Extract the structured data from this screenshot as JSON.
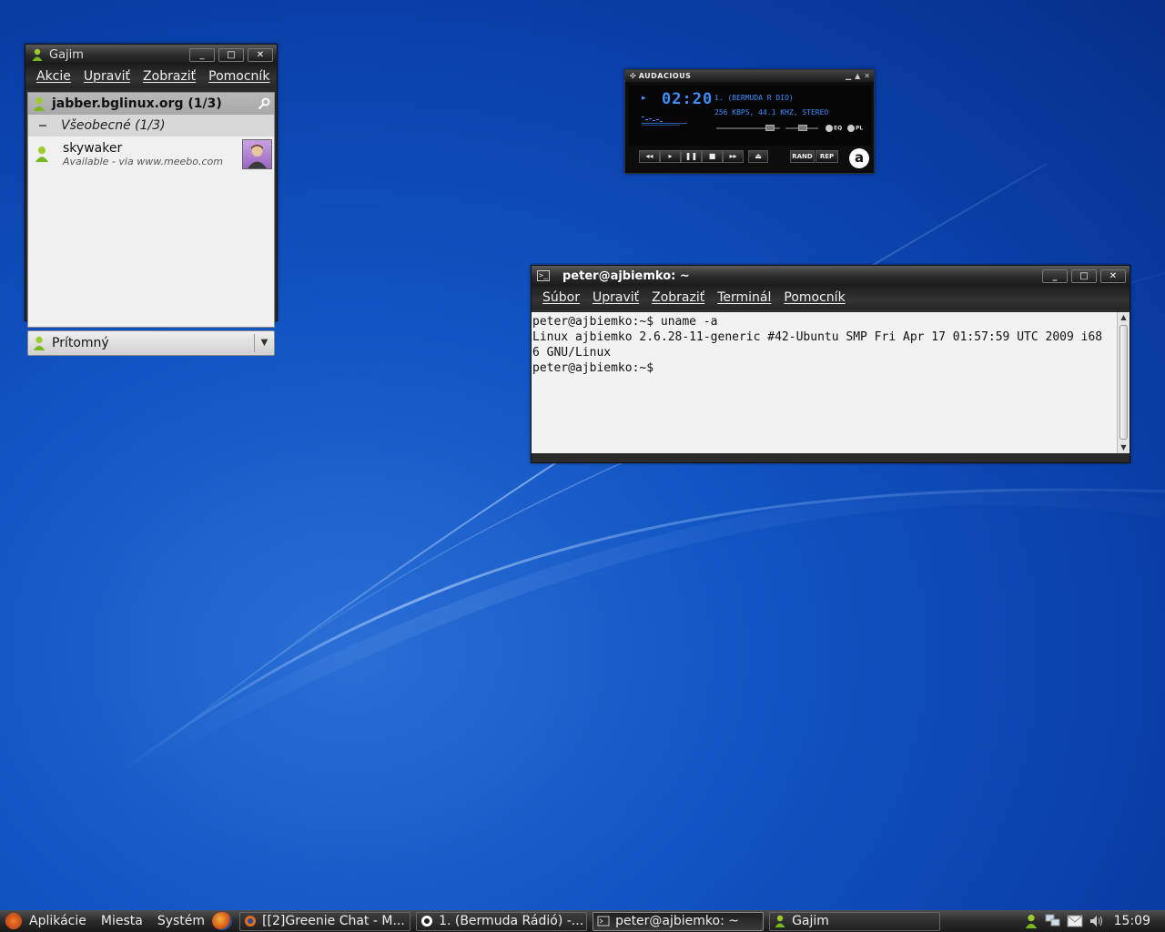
{
  "gajim": {
    "title": "Gajim",
    "window_buttons": [
      "_",
      "□",
      "✕"
    ],
    "menu": [
      "Akcie",
      "Upraviť",
      "Zobraziť",
      "Pomocník"
    ],
    "account": "jabber.bglinux.org (1/3)",
    "group": "Všeobecné (1/3)",
    "contact": {
      "name": "skywaker",
      "status": "Available - via www.meebo.com"
    },
    "status_combo": "Prítomný",
    "icons": {
      "account": "online-person-icon",
      "search": "search-key-icon",
      "expand": "chevron-down-icon"
    }
  },
  "audacious": {
    "title": "AUDACIOUS",
    "time": "02:20",
    "track": "1.  (BERMUDA R DIO)",
    "bitrate": "256 KBPS, 44.1 KHZ, STEREO",
    "toggles": [
      "EQ",
      "PL"
    ],
    "buttons": [
      "◂◂",
      "▸",
      "❚❚",
      "■",
      "▸▸"
    ],
    "eject": "⏏",
    "rand": "RAND",
    "rep": "REP",
    "logo": "a",
    "accent": "#3f8fff"
  },
  "terminal": {
    "title": "peter@ajbiemko: ~",
    "window_buttons": [
      "_",
      "□",
      "✕"
    ],
    "menu": [
      "Súbor",
      "Upraviť",
      "Zobraziť",
      "Terminál",
      "Pomocník"
    ],
    "lines": [
      "peter@ajbiemko:~$ uname -a",
      "Linux ajbiemko 2.6.28-11-generic #42-Ubuntu SMP Fri Apr 17 01:57:59 UTC 2009 i68",
      "6 GNU/Linux",
      "peter@ajbiemko:~$ "
    ]
  },
  "panel": {
    "menus": [
      "Aplikácie",
      "Miesta",
      "Systém"
    ],
    "tasks": [
      {
        "label": "[[2]Greenie Chat - M...",
        "icon": "firefox-icon"
      },
      {
        "label": "1.  (Bermuda Rádió) -...",
        "icon": "audacious-icon"
      },
      {
        "label": "peter@ajbiemko: ~",
        "icon": "terminal-icon"
      },
      {
        "label": "Gajim",
        "icon": "gajim-icon"
      }
    ],
    "clock": "15:09"
  }
}
